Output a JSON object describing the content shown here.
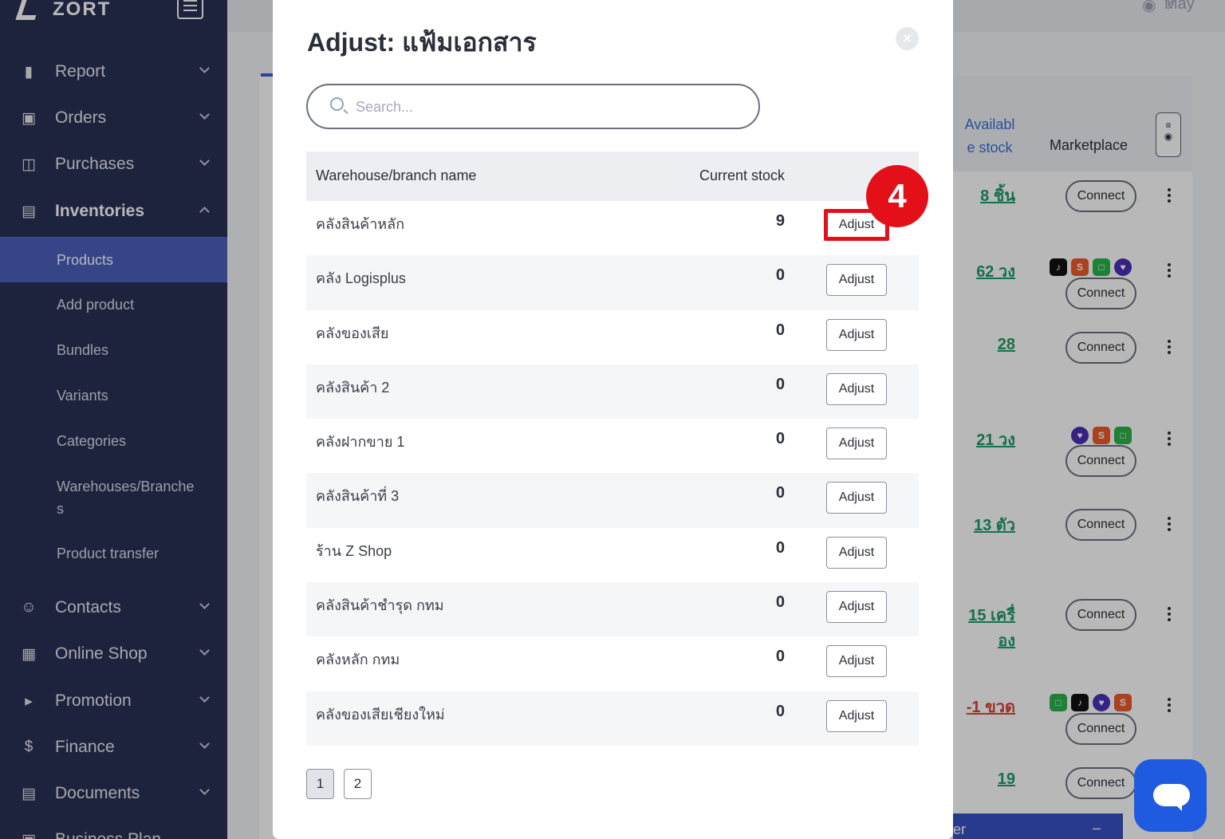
{
  "app": {
    "name": "ZORT"
  },
  "sidebar": {
    "items": [
      {
        "label": "Report",
        "icon": "bar-chart-icon"
      },
      {
        "label": "Orders",
        "icon": "clipboard-icon"
      },
      {
        "label": "Purchases",
        "icon": "basket-icon"
      },
      {
        "label": "Inventories",
        "icon": "box-icon"
      },
      {
        "label": "Contacts",
        "icon": "people-icon"
      },
      {
        "label": "Online Shop",
        "icon": "shop-icon"
      },
      {
        "label": "Promotion",
        "icon": "megaphone-icon"
      },
      {
        "label": "Finance",
        "icon": "dollar-icon"
      },
      {
        "label": "Documents",
        "icon": "document-icon"
      },
      {
        "label": "Business Plan",
        "icon": "briefcase-icon"
      }
    ],
    "sub_items": [
      "Products",
      "Add product",
      "Bundles",
      "Variants",
      "Categories",
      "Warehouses/Branche",
      "s",
      "Product transfer"
    ]
  },
  "topbar": {
    "user": "May"
  },
  "background_table": {
    "avail_header_1": "Availabl",
    "avail_header_2": "e stock",
    "marketplace_header": "Marketplace",
    "connect_label": "Connect",
    "rows": [
      {
        "qty": "8 ชิ้น"
      },
      {
        "qty": "62 วง"
      },
      {
        "qty": "28"
      },
      {
        "qty": "21 วง"
      },
      {
        "qty": "13 ตัว"
      },
      {
        "qty": "15 เครื่",
        "qty2": "อง"
      },
      {
        "qty": "-1 ขวด"
      },
      {
        "qty": "19"
      }
    ],
    "bottom_bar_text": "er",
    "bottom_bar_sign": "–"
  },
  "modal": {
    "title": "Adjust: แฟ้มเอกสาร",
    "close_label": "×",
    "search_placeholder": "Search...",
    "col_name": "Warehouse/branch name",
    "col_stock": "Current stock",
    "adjust_label": "Adjust",
    "step_number": "4",
    "rows": [
      {
        "name": "คลังสินค้าหลัก",
        "stock": "9"
      },
      {
        "name": "คลัง Logisplus",
        "stock": "0"
      },
      {
        "name": "คลังของเสีย",
        "stock": "0"
      },
      {
        "name": "คลังสินค้า 2",
        "stock": "0"
      },
      {
        "name": "คลังฝากขาย 1",
        "stock": "0"
      },
      {
        "name": "คลังสินค้าที่ 3",
        "stock": "0"
      },
      {
        "name": "ร้าน Z Shop",
        "stock": "0"
      },
      {
        "name": "คลังสินค้าชำรุด กทม",
        "stock": "0"
      },
      {
        "name": "คลังหลัก กทม",
        "stock": "0"
      },
      {
        "name": "คลังของเสียเชียงใหม่",
        "stock": "0"
      }
    ],
    "pages": [
      "1",
      "2"
    ]
  }
}
